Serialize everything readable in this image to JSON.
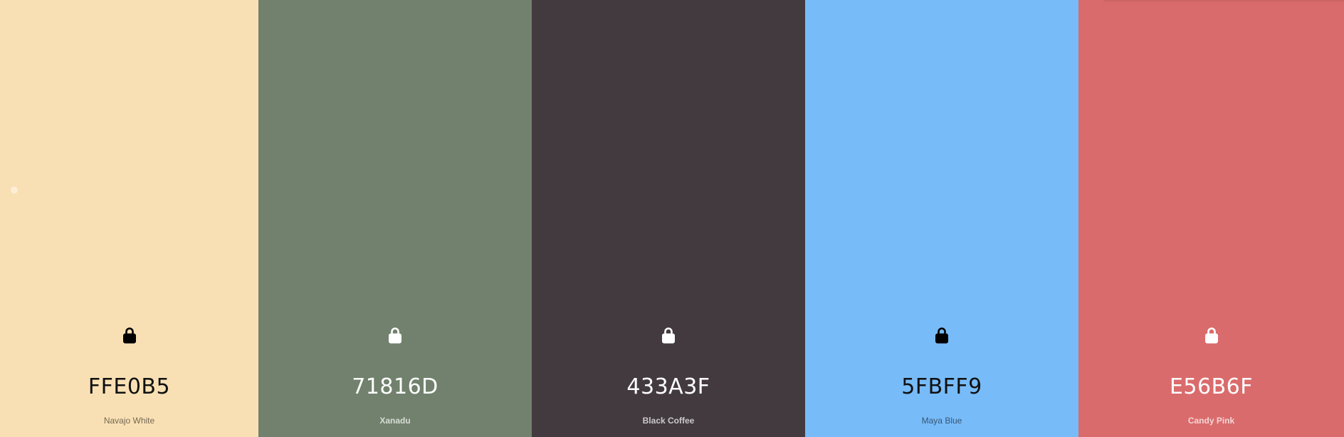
{
  "palette": {
    "swatches": [
      {
        "hex": "FFE0B5",
        "name": "Navajo White",
        "color": "#F9E0B4",
        "lock_icon": "lock-icon"
      },
      {
        "hex": "71816D",
        "name": "Xanadu",
        "color": "#71816D",
        "lock_icon": "lock-icon"
      },
      {
        "hex": "433A3F",
        "name": "Black Coffee",
        "color": "#433A3F",
        "lock_icon": "lock-icon"
      },
      {
        "hex": "5FBFF9",
        "name": "Maya Blue",
        "color": "#77BBF9",
        "lock_icon": "lock-icon"
      },
      {
        "hex": "E56B6F",
        "name": "Candy Pink",
        "color": "#DA6B6C",
        "lock_icon": "lock-icon"
      }
    ]
  }
}
